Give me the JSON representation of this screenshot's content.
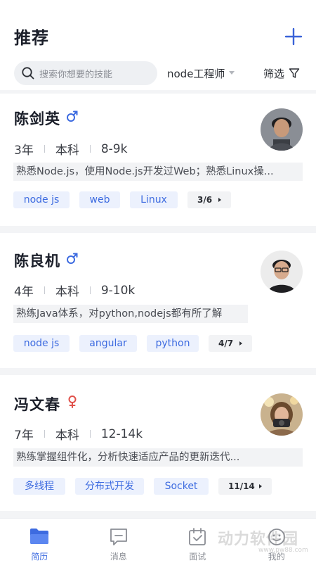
{
  "header": {
    "title": "推荐",
    "add_icon": "plus-icon",
    "search": {
      "placeholder": "搜索你想要的技能",
      "icon": "search-icon"
    },
    "job_filter": "node工程师",
    "filter_label": "筛选",
    "filter_icon": "funnel-icon"
  },
  "candidates": [
    {
      "name": "陈剑英",
      "gender": "male",
      "gender_symbol": "♂",
      "experience": "3年",
      "education": "本科",
      "salary": "8-9k",
      "description": "熟悉Node.js，使用Node.js开发过Web；熟悉Linux操...",
      "tags": [
        "node js",
        "web",
        "Linux"
      ],
      "tag_count": "3/6"
    },
    {
      "name": "陈良机",
      "gender": "male",
      "gender_symbol": "♂",
      "experience": "4年",
      "education": "本科",
      "salary": "9-10k",
      "description": "熟练Java体系，对python,nodejs都有所了解",
      "tags": [
        "node js",
        "angular",
        "python"
      ],
      "tag_count": "4/7"
    },
    {
      "name": "冯文春",
      "gender": "female",
      "gender_symbol": "♀",
      "experience": "7年",
      "education": "本科",
      "salary": "12-14k",
      "description": "熟练掌握组件化，分析快速适应产品的更新迭代...",
      "tags": [
        "多线程",
        "分布式开发",
        "Socket"
      ],
      "tag_count": "11/14"
    }
  ],
  "tabbar": {
    "items": [
      {
        "label": "简历",
        "icon": "folder-icon",
        "active": true
      },
      {
        "label": "消息",
        "icon": "message-icon",
        "active": false
      },
      {
        "label": "面试",
        "icon": "calendar-check-icon",
        "active": false
      },
      {
        "label": "我的",
        "icon": "profile-icon",
        "active": false
      }
    ]
  },
  "watermark": {
    "text": "动力软件园",
    "url": "www.pw88.com"
  },
  "colors": {
    "accent": "#3d6be0",
    "male": "#3d6be0",
    "female": "#e0504a",
    "tag_bg": "#ecf1fd"
  }
}
